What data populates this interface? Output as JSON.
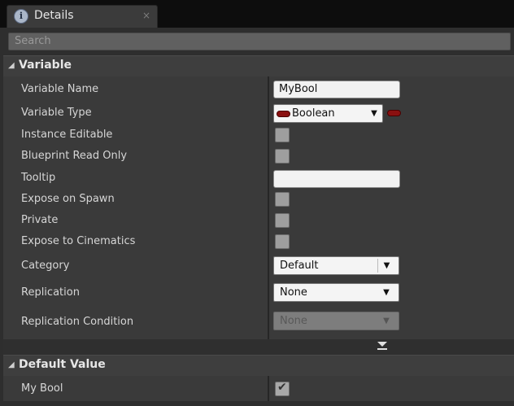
{
  "tab": {
    "title": "Details",
    "icon": "info-icon",
    "icon_glyph": "i",
    "close_glyph": "×"
  },
  "search": {
    "placeholder": "Search"
  },
  "variable_section": {
    "title": "Variable",
    "collapse_glyph": "◢",
    "variable_name": {
      "label": "Variable Name",
      "value": "MyBool"
    },
    "variable_type": {
      "label": "Variable Type",
      "value": "Boolean",
      "pill_color": "#8a1010"
    },
    "instance_editable": {
      "label": "Instance Editable",
      "checked": false
    },
    "blueprint_read_only": {
      "label": "Blueprint Read Only",
      "checked": false
    },
    "tooltip": {
      "label": "Tooltip",
      "value": ""
    },
    "expose_on_spawn": {
      "label": "Expose on Spawn",
      "checked": false
    },
    "private": {
      "label": "Private",
      "checked": false
    },
    "expose_to_cinematics": {
      "label": "Expose to Cinematics",
      "checked": false
    },
    "category": {
      "label": "Category",
      "value": "Default"
    },
    "replication": {
      "label": "Replication",
      "value": "None"
    },
    "replication_condition": {
      "label": "Replication Condition",
      "value": "None",
      "disabled": true
    }
  },
  "default_value_section": {
    "title": "Default Value",
    "collapse_glyph": "◢",
    "my_bool": {
      "label": "My Bool",
      "checked": true,
      "check_glyph": "✔"
    }
  },
  "dropdown_glyph": "▼"
}
